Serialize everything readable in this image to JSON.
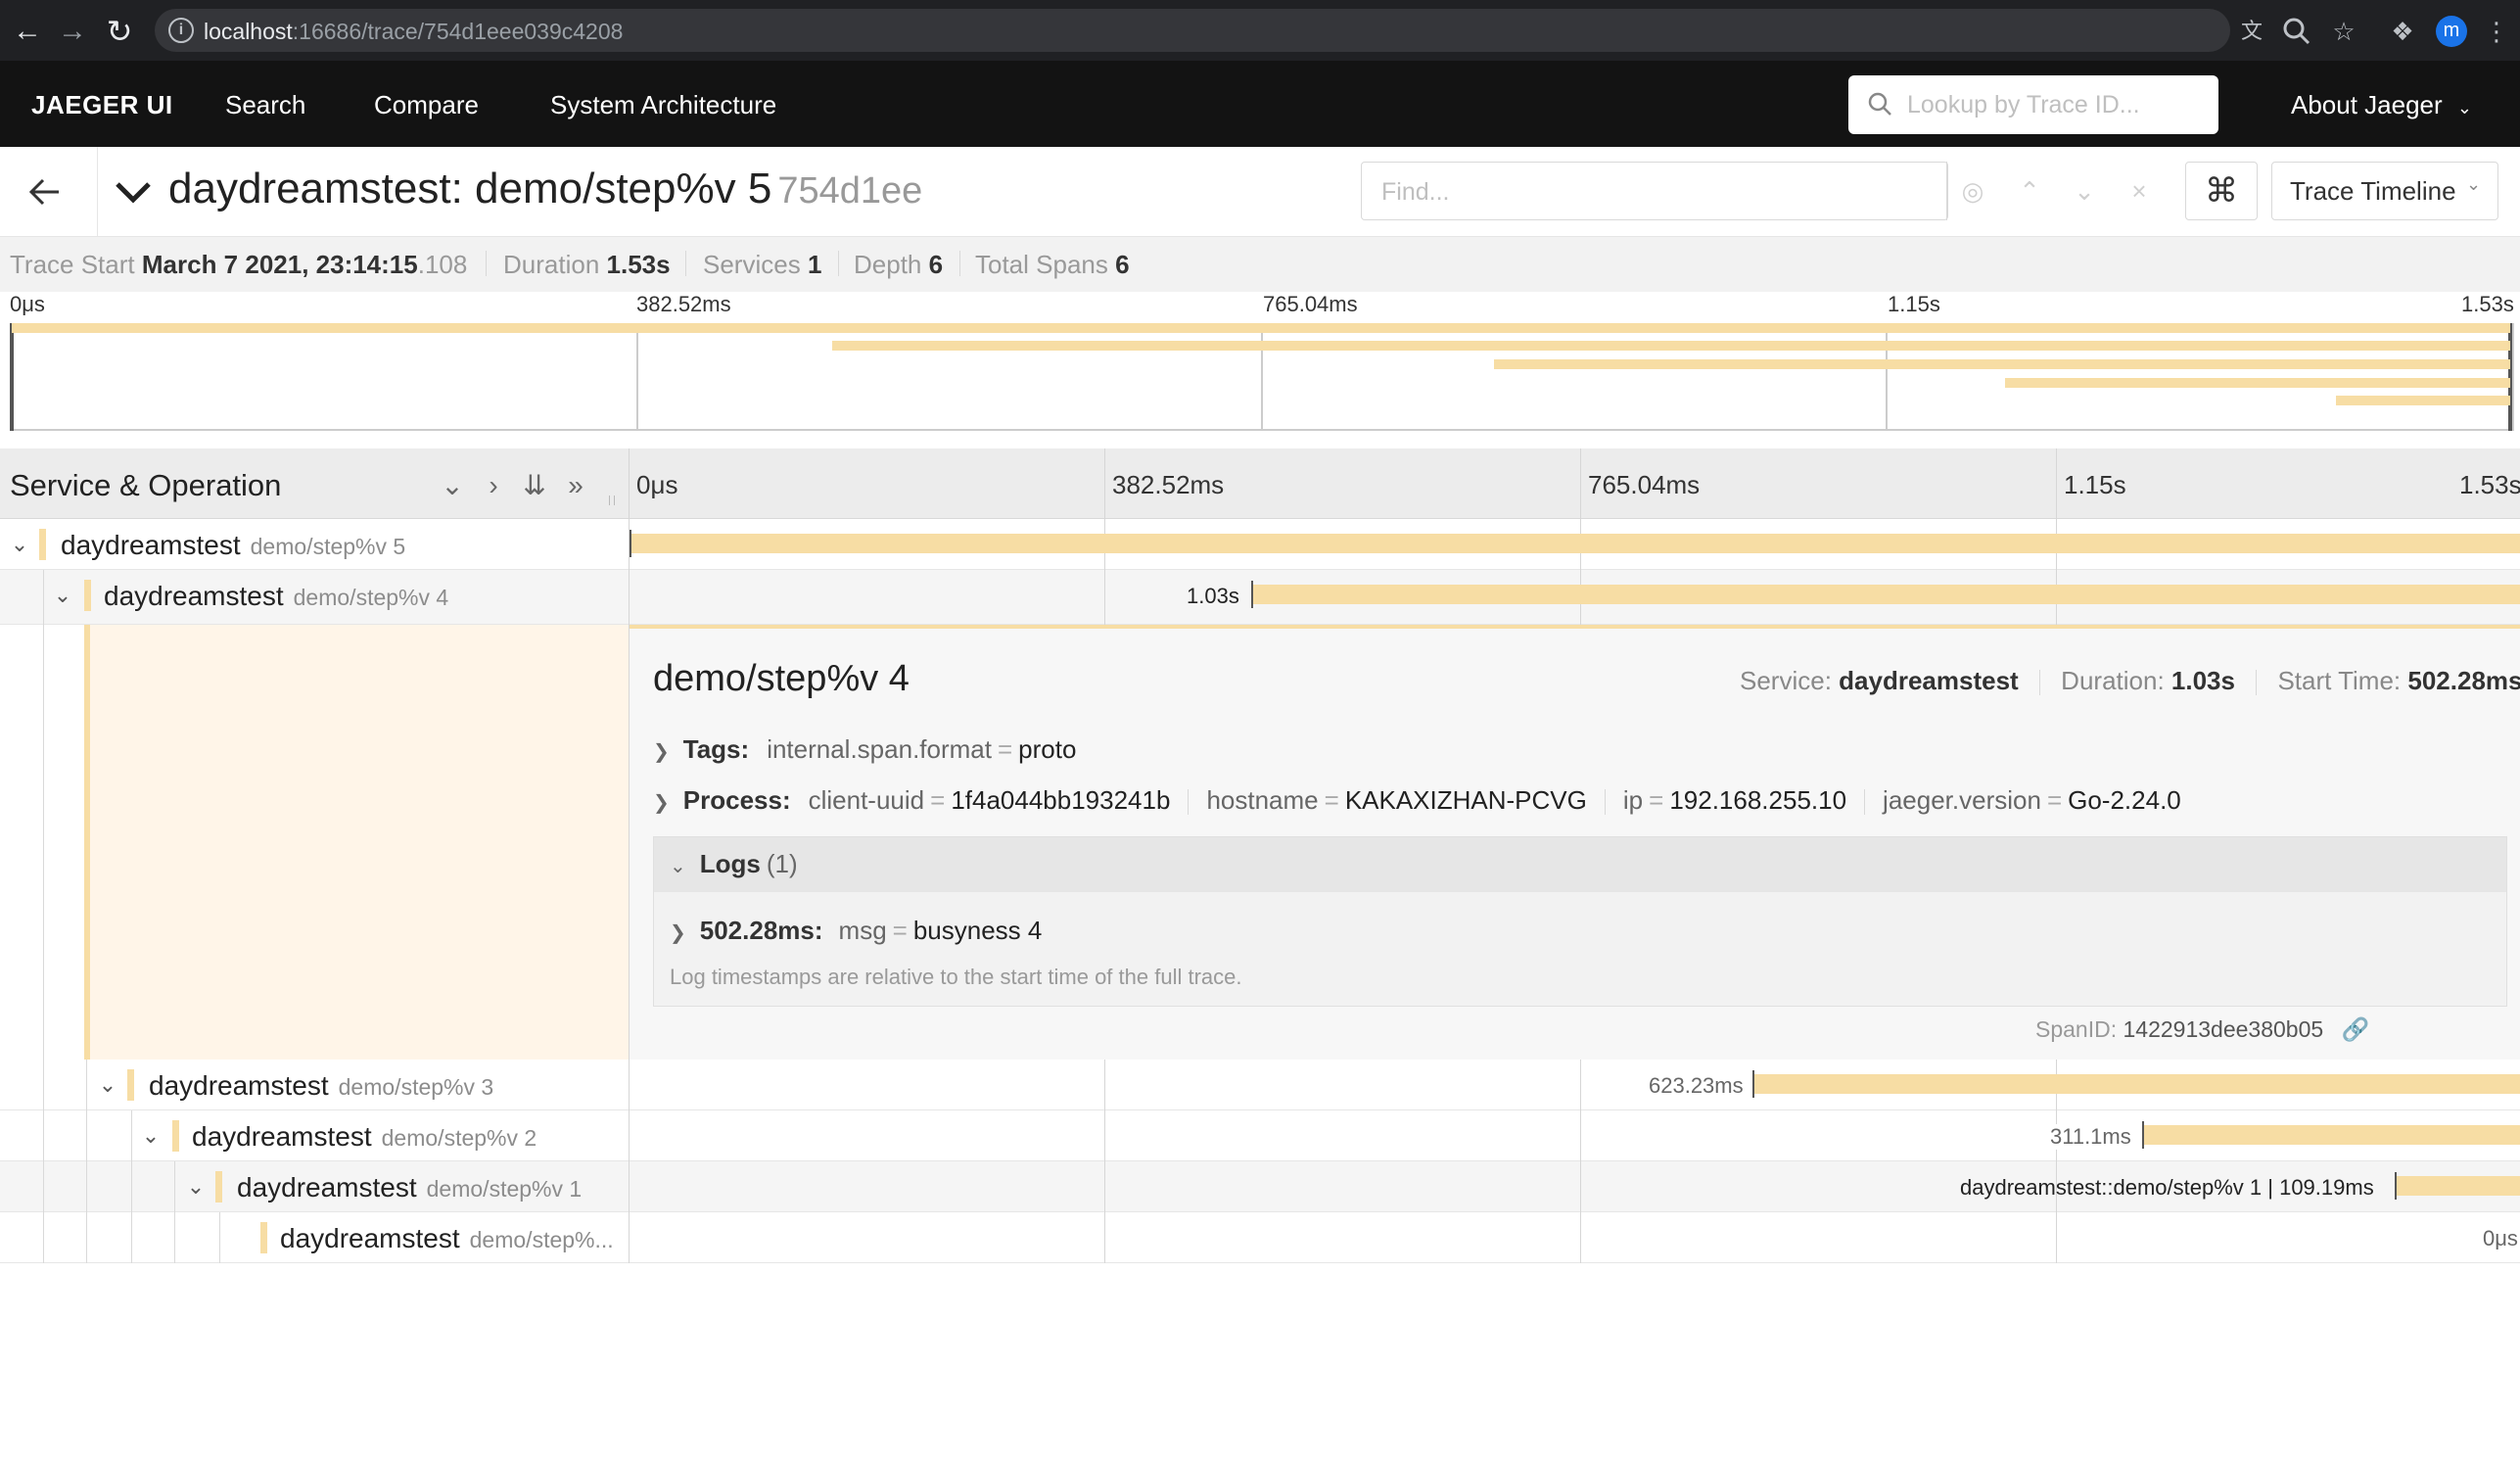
{
  "browser": {
    "url_host": "localhost",
    "url_rest": ":16686/trace/754d1eee039c4208",
    "profile_initial": "m"
  },
  "nav": {
    "brand": "JAEGER UI",
    "items": [
      "Search",
      "Compare",
      "System Architecture"
    ],
    "lookup_placeholder": "Lookup by Trace ID...",
    "about": "About Jaeger"
  },
  "trace": {
    "service": "daydreamstest",
    "operation": "demo/step%v 5",
    "title_sep": ": ",
    "trace_id_short": "754d1ee",
    "find_placeholder": "Find...",
    "view_mode": "Trace Timeline"
  },
  "summary": {
    "trace_start_label": "Trace Start",
    "trace_start_main": "March 7 2021, 23:14:15",
    "trace_start_ms": ".108",
    "duration_label": "Duration",
    "duration": "1.53s",
    "services_label": "Services",
    "services": "1",
    "depth_label": "Depth",
    "depth": "6",
    "total_spans_label": "Total Spans",
    "total_spans": "6"
  },
  "ticks": [
    "0μs",
    "382.52ms",
    "765.04ms",
    "1.15s",
    "1.53s"
  ],
  "timeline_header": {
    "title": "Service & Operation"
  },
  "spans": [
    {
      "service": "daydreamstest",
      "operation": "demo/step%v 5",
      "label": ""
    },
    {
      "service": "daydreamstest",
      "operation": "demo/step%v 4",
      "label": "1.03s"
    },
    {
      "service": "daydreamstest",
      "operation": "demo/step%v 3",
      "label": "623.23ms"
    },
    {
      "service": "daydreamstest",
      "operation": "demo/step%v 2",
      "label": "311.1ms"
    },
    {
      "service": "daydreamstest",
      "operation": "demo/step%v 1",
      "label": "daydreamstest::demo/step%v 1 | 109.19ms"
    },
    {
      "service": "daydreamstest",
      "operation": "demo/step%...",
      "label": "0μs"
    }
  ],
  "detail": {
    "title": "demo/step%v 4",
    "service_label": "Service:",
    "service": "daydreamstest",
    "duration_label": "Duration:",
    "duration": "1.03s",
    "start_label": "Start Time:",
    "start": "502.28ms",
    "tags_label": "Tags:",
    "tags": [
      {
        "key": "internal.span.format",
        "value": "proto"
      }
    ],
    "process_label": "Process:",
    "process": [
      {
        "key": "client-uuid",
        "value": "1f4a044bb193241b"
      },
      {
        "key": "hostname",
        "value": "KAKAXIZHAN-PCVG"
      },
      {
        "key": "ip",
        "value": "192.168.255.10"
      },
      {
        "key": "jaeger.version",
        "value": "Go-2.24.0"
      }
    ],
    "logs_label": "Logs",
    "logs_count": "(1)",
    "log_time": "502.28ms:",
    "log_fields": [
      {
        "key": "msg",
        "value": "busyness 4"
      }
    ],
    "logs_note": "Log timestamps are relative to the start time of the full trace.",
    "spanid_label": "SpanID:",
    "spanid": "1422913dee380b05"
  },
  "colors": {
    "span": "#f7dda4",
    "nav_bg": "#131313",
    "detail_bg": "#fff5e8"
  },
  "icons": [
    "back-arrow-icon",
    "forward-arrow-icon",
    "reload-icon",
    "info-icon",
    "translate-icon",
    "zoom-icon",
    "star-icon",
    "extension-icon",
    "menu-icon",
    "search-icon",
    "chevron-down-icon",
    "arrow-left-icon",
    "locate-icon",
    "chevron-up-icon",
    "close-icon",
    "command-icon",
    "link-icon"
  ]
}
